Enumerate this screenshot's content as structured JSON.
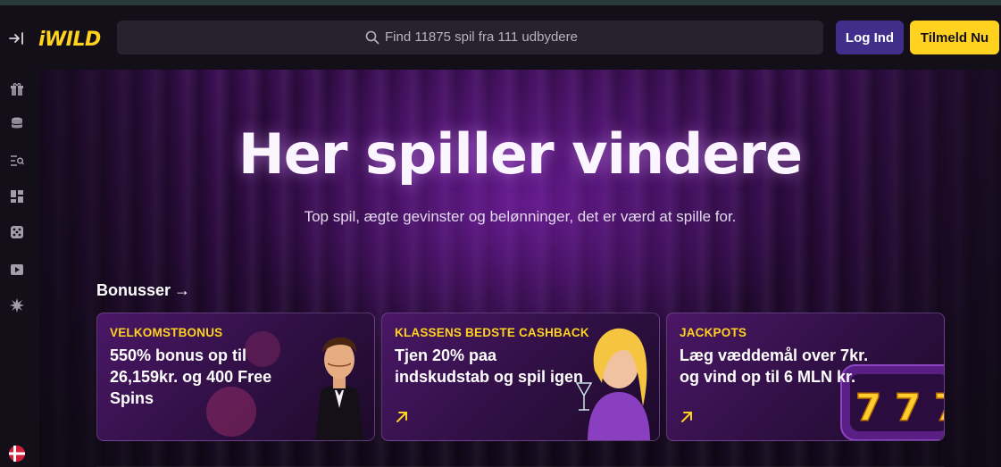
{
  "header": {
    "logo": "iWILD",
    "search_placeholder": "Find 11875 spil fra 111 udbydere",
    "login_label": "Log Ind",
    "signup_label": "Tilmeld Nu"
  },
  "sidebar": {
    "icons": [
      "gift-icon",
      "coins-icon",
      "list-search-icon",
      "grid-icon",
      "dice-icon",
      "play-icon",
      "star-burst-icon",
      "flag-dk-icon"
    ]
  },
  "hero": {
    "title": "Her spiller vindere",
    "subtitle": "Top spil, ægte gevinster og belønninger, det er værd at spille for."
  },
  "bonuses": {
    "heading": "Bonusser",
    "cards": [
      {
        "tag": "VELKOMSTBONUS",
        "text": "550% bonus op til 26,159kr. og 400 Free Spins"
      },
      {
        "tag": "KLASSENS BEDSTE CASHBACK",
        "text": "Tjen 20% paa indskudstab og spil igen"
      },
      {
        "tag": "JACKPOTS",
        "text": "Læg væddemål over 7kr. og vind op til 6 MLN kr."
      }
    ]
  },
  "colors": {
    "accent_yellow": "#ffd21f",
    "login_purple": "#3f2e8a",
    "background": "#0d0a12"
  }
}
